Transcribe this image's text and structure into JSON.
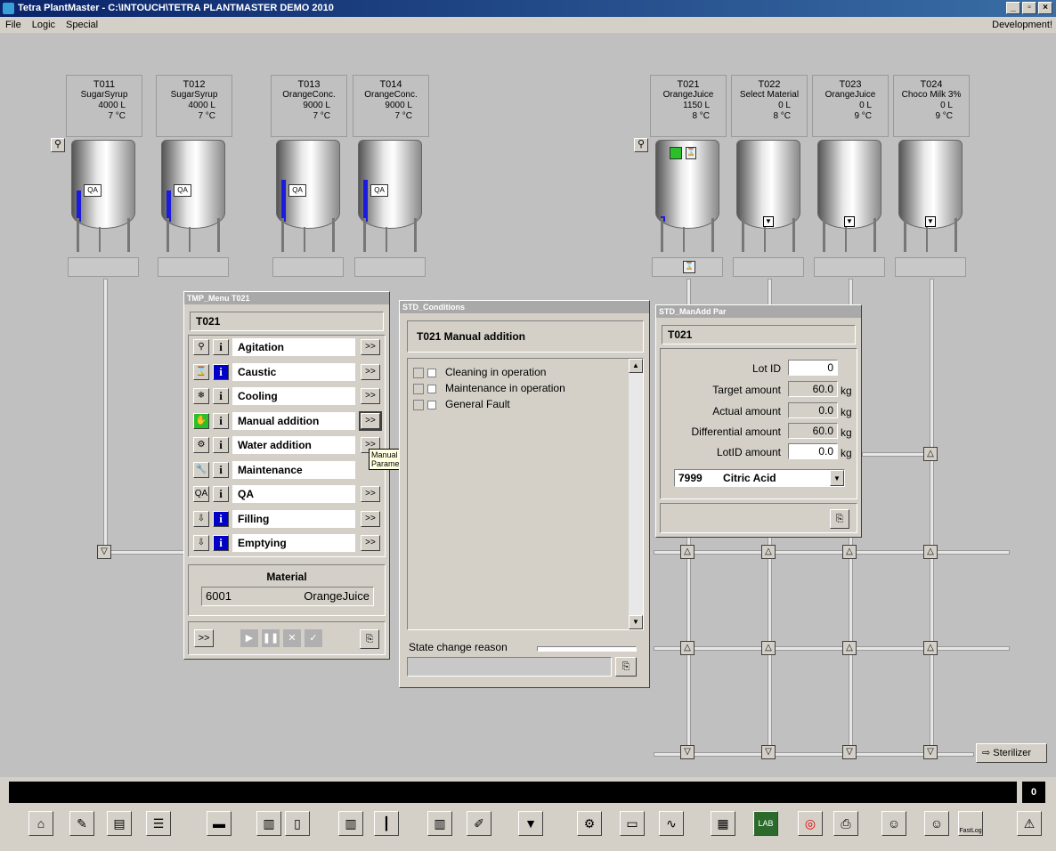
{
  "window": {
    "title": "Tetra PlantMaster - C:\\INTOUCH\\TETRA PLANTMASTER DEMO 2010",
    "min": "_",
    "max": "▫",
    "close": "×"
  },
  "menubar": {
    "file": "File",
    "logic": "Logic",
    "special": "Special",
    "mode": "Development!"
  },
  "tanks": [
    {
      "id": "T011",
      "product": "SugarSyrup",
      "volume": "4000 L",
      "temp": "7 °C",
      "qa": "QA",
      "level_fraction": 0.45
    },
    {
      "id": "T012",
      "product": "SugarSyrup",
      "volume": "4000 L",
      "temp": "7 °C",
      "qa": "QA",
      "level_fraction": 0.45
    },
    {
      "id": "T013",
      "product": "OrangeConc.",
      "volume": "9000 L",
      "temp": "7 °C",
      "qa": "QA",
      "level_fraction": 0.6
    },
    {
      "id": "T014",
      "product": "OrangeConc.",
      "volume": "9000 L",
      "temp": "7 °C",
      "qa": "QA",
      "level_fraction": 0.6
    },
    {
      "id": "T021",
      "product": "OrangeJuice",
      "volume": "1150 L",
      "temp": "8 °C",
      "level_fraction": 0.08
    },
    {
      "id": "T022",
      "product": "Select Material",
      "volume": "0 L",
      "temp": "8 °C",
      "level_fraction": 0
    },
    {
      "id": "T023",
      "product": "OrangeJuice",
      "volume": "0 L",
      "temp": "9 °C",
      "level_fraction": 0
    },
    {
      "id": "T024",
      "product": "Choco Milk 3%",
      "volume": "0 L",
      "temp": "9 °C",
      "level_fraction": 0
    }
  ],
  "tmp_menu": {
    "window_title": "TMP_Menu T021",
    "header": "T021",
    "rows": [
      {
        "label": "Agitation",
        "go": ">>"
      },
      {
        "label": "Caustic",
        "go": ">>"
      },
      {
        "label": "Cooling",
        "go": ">>"
      },
      {
        "label": "Manual addition",
        "go": ">>"
      },
      {
        "label": "Water addition",
        "go": ">>"
      },
      {
        "label": "Maintenance"
      },
      {
        "label": "QA",
        "go": ">>"
      },
      {
        "label": "Filling",
        "go": ">>"
      },
      {
        "label": "Emptying",
        "go": ">>"
      }
    ],
    "icons": [
      "agitator-icon",
      "caustic-icon",
      "cooling-icon",
      "manual-add-icon",
      "water-icon",
      "wrench-icon",
      "qa-icon",
      "filling-icon",
      "emptying-icon"
    ],
    "icon_glyphs": [
      "⚲",
      "⌛",
      "❄",
      "✋",
      "⚙",
      "🔧",
      "QA",
      "⇩",
      "⇩"
    ],
    "info_glyph": "i",
    "material_title": "Material",
    "material_code": "6001",
    "material_name": "OrangeJuice",
    "nav_btn": ">>",
    "tooltip_line1": "Manual addition",
    "tooltip_line2": "Parameters"
  },
  "conditions": {
    "window_title": "STD_Conditions",
    "header": "T021 Manual addition",
    "items": [
      "Cleaning in operation",
      "Maintenance in operation",
      "General Fault"
    ],
    "state_change_label": "State change reason"
  },
  "manadd": {
    "window_title": "STD_ManAdd Par",
    "header": "T021",
    "lot_id_label": "Lot ID",
    "lot_id_value": "0",
    "target_label": "Target amount",
    "target_value": "60.0",
    "actual_label": "Actual amount",
    "actual_value": "0.0",
    "diff_label": "Differential amount",
    "diff_value": "60.0",
    "lotid_amount_label": "LotID amount",
    "lotid_amount_value": "0.0",
    "unit": "kg",
    "material_code": "7999",
    "material_name": "Citric Acid"
  },
  "sterilizer_label": "Sterilizer",
  "status": {
    "count": "0"
  },
  "toolbar_icons": [
    "home-icon",
    "notepad-icon",
    "keyboard-icon",
    "list-icon",
    "truck-icon",
    "tank-p-icon",
    "tank-icon",
    "tank-s-icon",
    "valve-icon",
    "mixer-icon",
    "document-icon",
    "tank-down-icon",
    "gears-icon",
    "chart-icon",
    "trend-icon",
    "calculator-icon",
    "lab-icon",
    "alarm-icon",
    "print-icon",
    "user-key-icon",
    "user-edit-icon",
    "fastlog-icon",
    "warning-icon"
  ],
  "toolbar_lab": "LAB",
  "toolbar_fastlog": "FastLog"
}
